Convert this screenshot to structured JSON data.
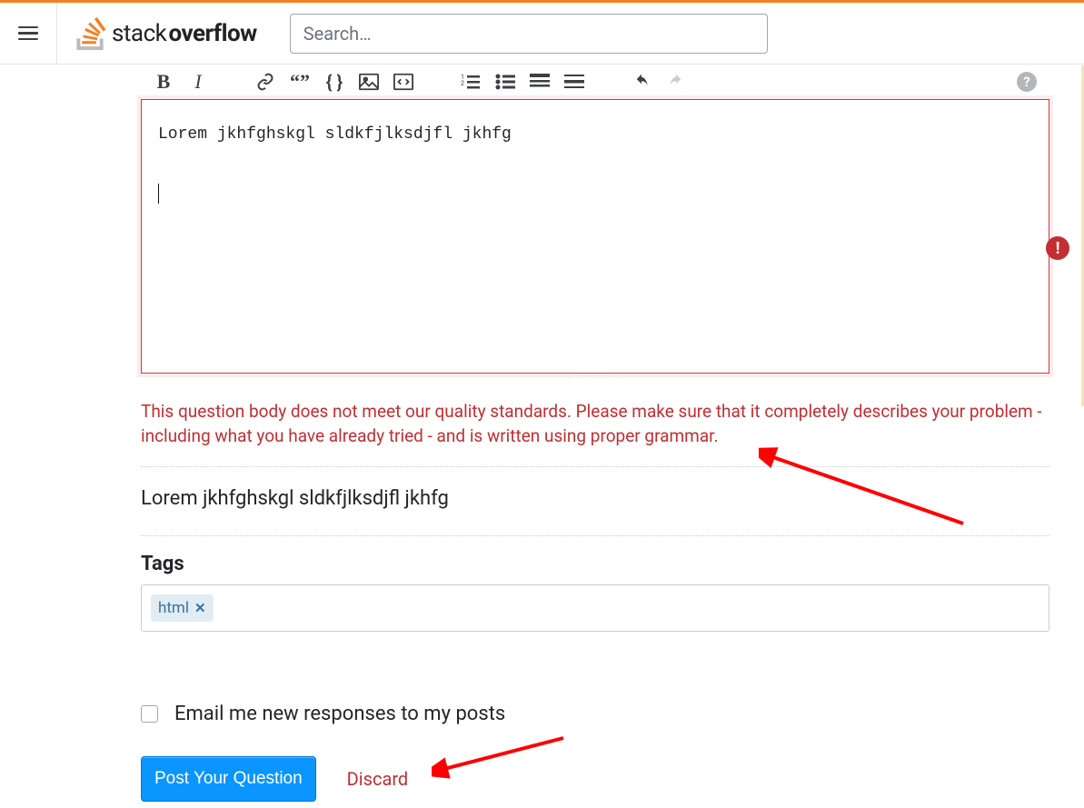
{
  "header": {
    "brand_prefix": "stack",
    "brand_suffix": "overflow",
    "search_placeholder": "Search…"
  },
  "editor": {
    "body_text": "Lorem jkhfghskgl sldkfjlksdjfl jkhfg",
    "error_message": "This question body does not meet our quality standards. Please make sure that it completely describes your problem - including what you have already tried - and is written using proper grammar.",
    "preview_text": "Lorem jkhfghskgl sldkfjlksdjfl jkhfg"
  },
  "tags": {
    "label": "Tags",
    "items": [
      "html"
    ]
  },
  "email": {
    "label": "Email me new responses to my posts",
    "checked": false
  },
  "actions": {
    "post_label": "Post Your Question",
    "discard_label": "Discard"
  },
  "icons": {
    "error_glyph": "!"
  }
}
